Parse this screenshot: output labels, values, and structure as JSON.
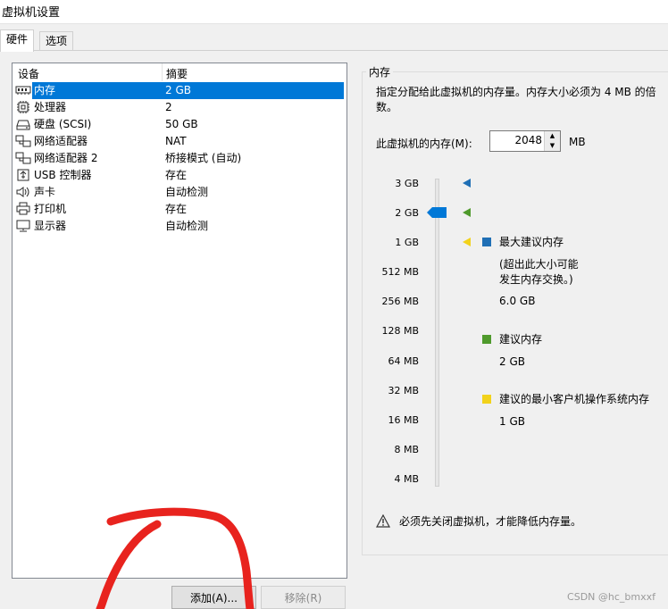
{
  "window": {
    "title": "虚拟机设置"
  },
  "tabs": [
    {
      "label": "硬件",
      "active": true
    },
    {
      "label": "选项",
      "active": false
    }
  ],
  "device_list": {
    "headers": {
      "device": "设备",
      "summary": "摘要"
    },
    "rows": [
      {
        "name": "内存",
        "summary": "2 GB",
        "icon": "memory-icon",
        "selected": true
      },
      {
        "name": "处理器",
        "summary": "2",
        "icon": "processor-icon",
        "selected": false
      },
      {
        "name": "硬盘 (SCSI)",
        "summary": "50 GB",
        "icon": "hard-disk-icon",
        "selected": false
      },
      {
        "name": "网络适配器",
        "summary": "NAT",
        "icon": "network-adapter-icon",
        "selected": false
      },
      {
        "name": "网络适配器 2",
        "summary": "桥接模式 (自动)",
        "icon": "network-adapter-icon",
        "selected": false
      },
      {
        "name": "USB 控制器",
        "summary": "存在",
        "icon": "usb-icon",
        "selected": false
      },
      {
        "name": "声卡",
        "summary": "自动检测",
        "icon": "sound-icon",
        "selected": false
      },
      {
        "name": "打印机",
        "summary": "存在",
        "icon": "printer-icon",
        "selected": false
      },
      {
        "name": "显示器",
        "summary": "自动检测",
        "icon": "monitor-icon",
        "selected": false
      }
    ]
  },
  "buttons": {
    "add": "添加(A)...",
    "remove": "移除(R)"
  },
  "memory": {
    "group_title": "内存",
    "description": "指定分配给此虚拟机的内存量。内存大小必须为 4 MB 的倍数。",
    "field_label": "此虚拟机的内存(M):",
    "value": "2048",
    "unit": "MB",
    "scale": [
      "3 GB",
      "2 GB",
      "1 GB",
      "512 MB",
      "256 MB",
      "128 MB",
      "64 MB",
      "32 MB",
      "16 MB",
      "8 MB",
      "4 MB"
    ],
    "slider_value": "2 GB",
    "legend": [
      {
        "label": "最大建议内存",
        "note": "(超出此大小可能\n发生内存交换。)",
        "value": "6.0 GB",
        "color": "#1f6fb5"
      },
      {
        "label": "建议内存",
        "note": "",
        "value": "2 GB",
        "color": "#4f9a2c"
      },
      {
        "label": "建议的最小客户机操作系统内存",
        "note": "",
        "value": "1 GB",
        "color": "#f2d21b"
      }
    ],
    "warning": "必须先关闭虚拟机，才能降低内存量。"
  },
  "watermark": "CSDN @hc_bmxxf",
  "colors": {
    "selection": "#0078d7",
    "annotation": "#e8231e"
  }
}
